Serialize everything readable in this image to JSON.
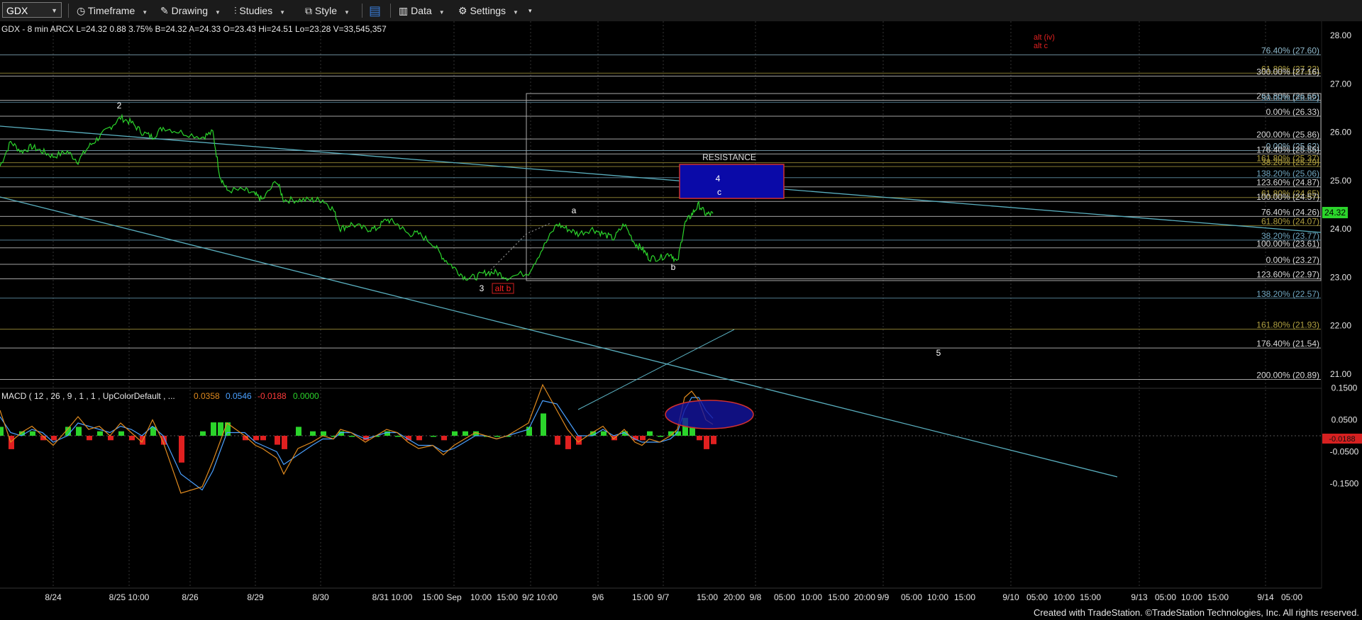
{
  "toolbar": {
    "symbol": "GDX",
    "menus": [
      "Timeframe",
      "Drawing",
      "Studies",
      "Style",
      "Data",
      "Settings"
    ]
  },
  "header": {
    "text": "GDX - 8 min  ARCX  L=24.32  0.88  3.75%  B=24.32  A=24.33  O=23.43  Hi=24.51  Lo=23.28  V=33,545,357"
  },
  "last_price_tag": "24.32",
  "resistance_label": "RESISTANCE",
  "alt_labels": [
    "alt (iv)",
    "alt c"
  ],
  "macd_header": {
    "text": "MACD ( 12 , 26 , 9 , 1 , 1 , UpColorDefault , ...",
    "values": [
      "0.0358",
      "0.0546",
      "-0.0188",
      "0.0000"
    ],
    "colors": [
      "#e08a1e",
      "#4aa0ff",
      "#ff3b3b",
      "#2bd42b"
    ]
  },
  "macd_last_tag": "-0.0188",
  "footer": "Created with TradeStation. ©TradeStation Technologies, Inc. All rights reserved.",
  "chart_data": {
    "type": "line",
    "price_y_ticks": [
      "28.00",
      "27.00",
      "26.00",
      "25.00",
      "24.00",
      "23.00",
      "22.00",
      "21.00"
    ],
    "macd_y_ticks": [
      "0.1500",
      "0.0500",
      "-0.0500",
      "-0.1500"
    ],
    "x_tick_labels": [
      "8/24",
      "8/25 10:00",
      "8/26",
      "8/29",
      "8/30",
      "8/31 10:00",
      "15:00",
      "Sep",
      "10:00",
      "15:00",
      "9/2 10:00",
      "9/6",
      "15:00",
      "9/7",
      "15:00",
      "20:00",
      "9/8",
      "05:00",
      "10:00",
      "15:00",
      "20:00",
      "9/9",
      "05:00",
      "10:00",
      "15:00",
      "9/10",
      "05:00",
      "10:00",
      "15:00",
      "9/13",
      "05:00",
      "10:00",
      "15:00",
      "9/14",
      "05:00"
    ],
    "wave_labels": [
      {
        "text": "2",
        "color": "#ffffff"
      },
      {
        "text": "3",
        "color": "#ffffff"
      },
      {
        "text": "alt b",
        "color": "#ff2020"
      },
      {
        "text": "a",
        "color": "#ffffff"
      },
      {
        "text": "b",
        "color": "#ffffff"
      },
      {
        "text": "4",
        "color": "#ffffff"
      },
      {
        "text": "c",
        "color": "#ffffff"
      },
      {
        "text": "5",
        "color": "#ffffff"
      }
    ],
    "fib_levels": [
      {
        "label": "76.40% (27.60)",
        "color": "#8fb9cc"
      },
      {
        "label": "61.80% (27.22)",
        "color": "#b0a040"
      },
      {
        "label": "300.00% (27.16)",
        "color": "#d8d8d8"
      },
      {
        "label": "261.80% (26.66)",
        "color": "#d8d8d8"
      },
      {
        "label": "50.00% (26.62)",
        "color": "#6fa6c0"
      },
      {
        "label": "0.00% (26.33)",
        "color": "#d8d8d8"
      },
      {
        "label": "200.00% (25.86)",
        "color": "#d8d8d8"
      },
      {
        "label": "0.00% (25.62)",
        "color": "#8fb9cc"
      },
      {
        "label": "176.40% (25.55)",
        "color": "#d8d8d8"
      },
      {
        "label": "161.80% (25.37)",
        "color": "#b0a040"
      },
      {
        "label": "38.20% (25.29)",
        "color": "#b0a040"
      },
      {
        "label": "138.20% (25.06)",
        "color": "#6fa6c0"
      },
      {
        "label": "123.60% (24.87)",
        "color": "#d8d8d8"
      },
      {
        "label": "61.80% (24.65)",
        "color": "#b0a040"
      },
      {
        "label": "100.00% (24.57)",
        "color": "#d8d8d8"
      },
      {
        "label": "76.40% (24.26)",
        "color": "#d8d8d8"
      },
      {
        "label": "61.80% (24.07)",
        "color": "#b0a040"
      },
      {
        "label": "38.20% (23.77)",
        "color": "#6fa6c0"
      },
      {
        "label": "100.00% (23.61)",
        "color": "#d8d8d8"
      },
      {
        "label": "0.00% (23.27)",
        "color": "#d8d8d8"
      },
      {
        "label": "123.60% (22.97)",
        "color": "#d8d8d8"
      },
      {
        "label": "138.20% (22.57)",
        "color": "#6fa6c0"
      },
      {
        "label": "161.80% (21.93)",
        "color": "#b0a040"
      },
      {
        "label": "176.40% (21.54)",
        "color": "#d8d8d8"
      },
      {
        "label": "200.00% (20.89)",
        "color": "#d8d8d8"
      }
    ],
    "resistance_zone": [
      24.65,
      25.35
    ],
    "price_range": [
      20.5,
      28.3
    ],
    "price_series": [
      25.3,
      25.8,
      25.6,
      25.7,
      25.6,
      25.5,
      25.6,
      25.4,
      25.7,
      25.9,
      26.1,
      26.3,
      26.2,
      26.0,
      25.9,
      26.1,
      26.0,
      25.9,
      26.0,
      25.1,
      24.8,
      24.8,
      24.7,
      24.6,
      25.0,
      24.6,
      24.6,
      24.6,
      24.6,
      24.4,
      24.0,
      24.1,
      24.0,
      24.0,
      24.2,
      24.1,
      23.9,
      23.9,
      23.7,
      23.4,
      23.2,
      23.0,
      23.0,
      23.1,
      23.1,
      23.0,
      23.1,
      23.6,
      24.1,
      24.0,
      23.9,
      24.0,
      23.9,
      23.8,
      24.1,
      23.7,
      23.6,
      23.4,
      23.4,
      23.5,
      23.3,
      24.1,
      24.3,
      24.5,
      24.3,
      24.32
    ],
    "macd_range": [
      -0.2,
      0.2
    ],
    "macd_line": [
      0.08,
      -0.02,
      0.01,
      0.03,
      0.0,
      -0.03,
      0.02,
      0.06,
      0.02,
      0.03,
      0.0,
      0.04,
      0.01,
      -0.02,
      0.05,
      -0.02,
      -0.18,
      -0.16,
      -0.08,
      -0.02,
      0.04,
      0.0,
      -0.03,
      -0.04,
      -0.07,
      -0.12,
      -0.04,
      -0.02,
      0.0,
      -0.01,
      0.02,
      0.01,
      -0.02,
      0.0,
      0.02,
      0.01,
      -0.02,
      -0.04,
      -0.03,
      -0.06,
      -0.03,
      -0.01,
      0.01,
      0.0,
      -0.01,
      0.0,
      0.04,
      0.16,
      0.08,
      0.02,
      -0.02,
      0.01,
      0.03,
      -0.01,
      0.02,
      -0.02,
      -0.03,
      -0.01,
      -0.02,
      0.0,
      0.02,
      0.12,
      0.14,
      0.11,
      0.05,
      0.0358
    ],
    "macd_signal": [
      0.06,
      0.01,
      0.0,
      0.02,
      0.01,
      -0.02,
      0.0,
      0.04,
      0.03,
      0.02,
      0.01,
      0.03,
      0.02,
      0.0,
      0.03,
      0.0,
      -0.12,
      -0.17,
      -0.11,
      -0.05,
      0.01,
      0.01,
      -0.02,
      -0.03,
      -0.05,
      -0.09,
      -0.06,
      -0.03,
      -0.01,
      -0.01,
      0.01,
      0.01,
      -0.01,
      0.0,
      0.01,
      0.01,
      -0.01,
      -0.03,
      -0.03,
      -0.05,
      -0.04,
      -0.02,
      0.0,
      0.0,
      -0.01,
      0.0,
      0.02,
      0.11,
      0.1,
      0.05,
      0.0,
      0.0,
      0.02,
      0.0,
      0.01,
      -0.01,
      -0.02,
      -0.02,
      -0.02,
      -0.01,
      0.01,
      0.08,
      0.12,
      0.12,
      0.08,
      0.0546
    ]
  }
}
